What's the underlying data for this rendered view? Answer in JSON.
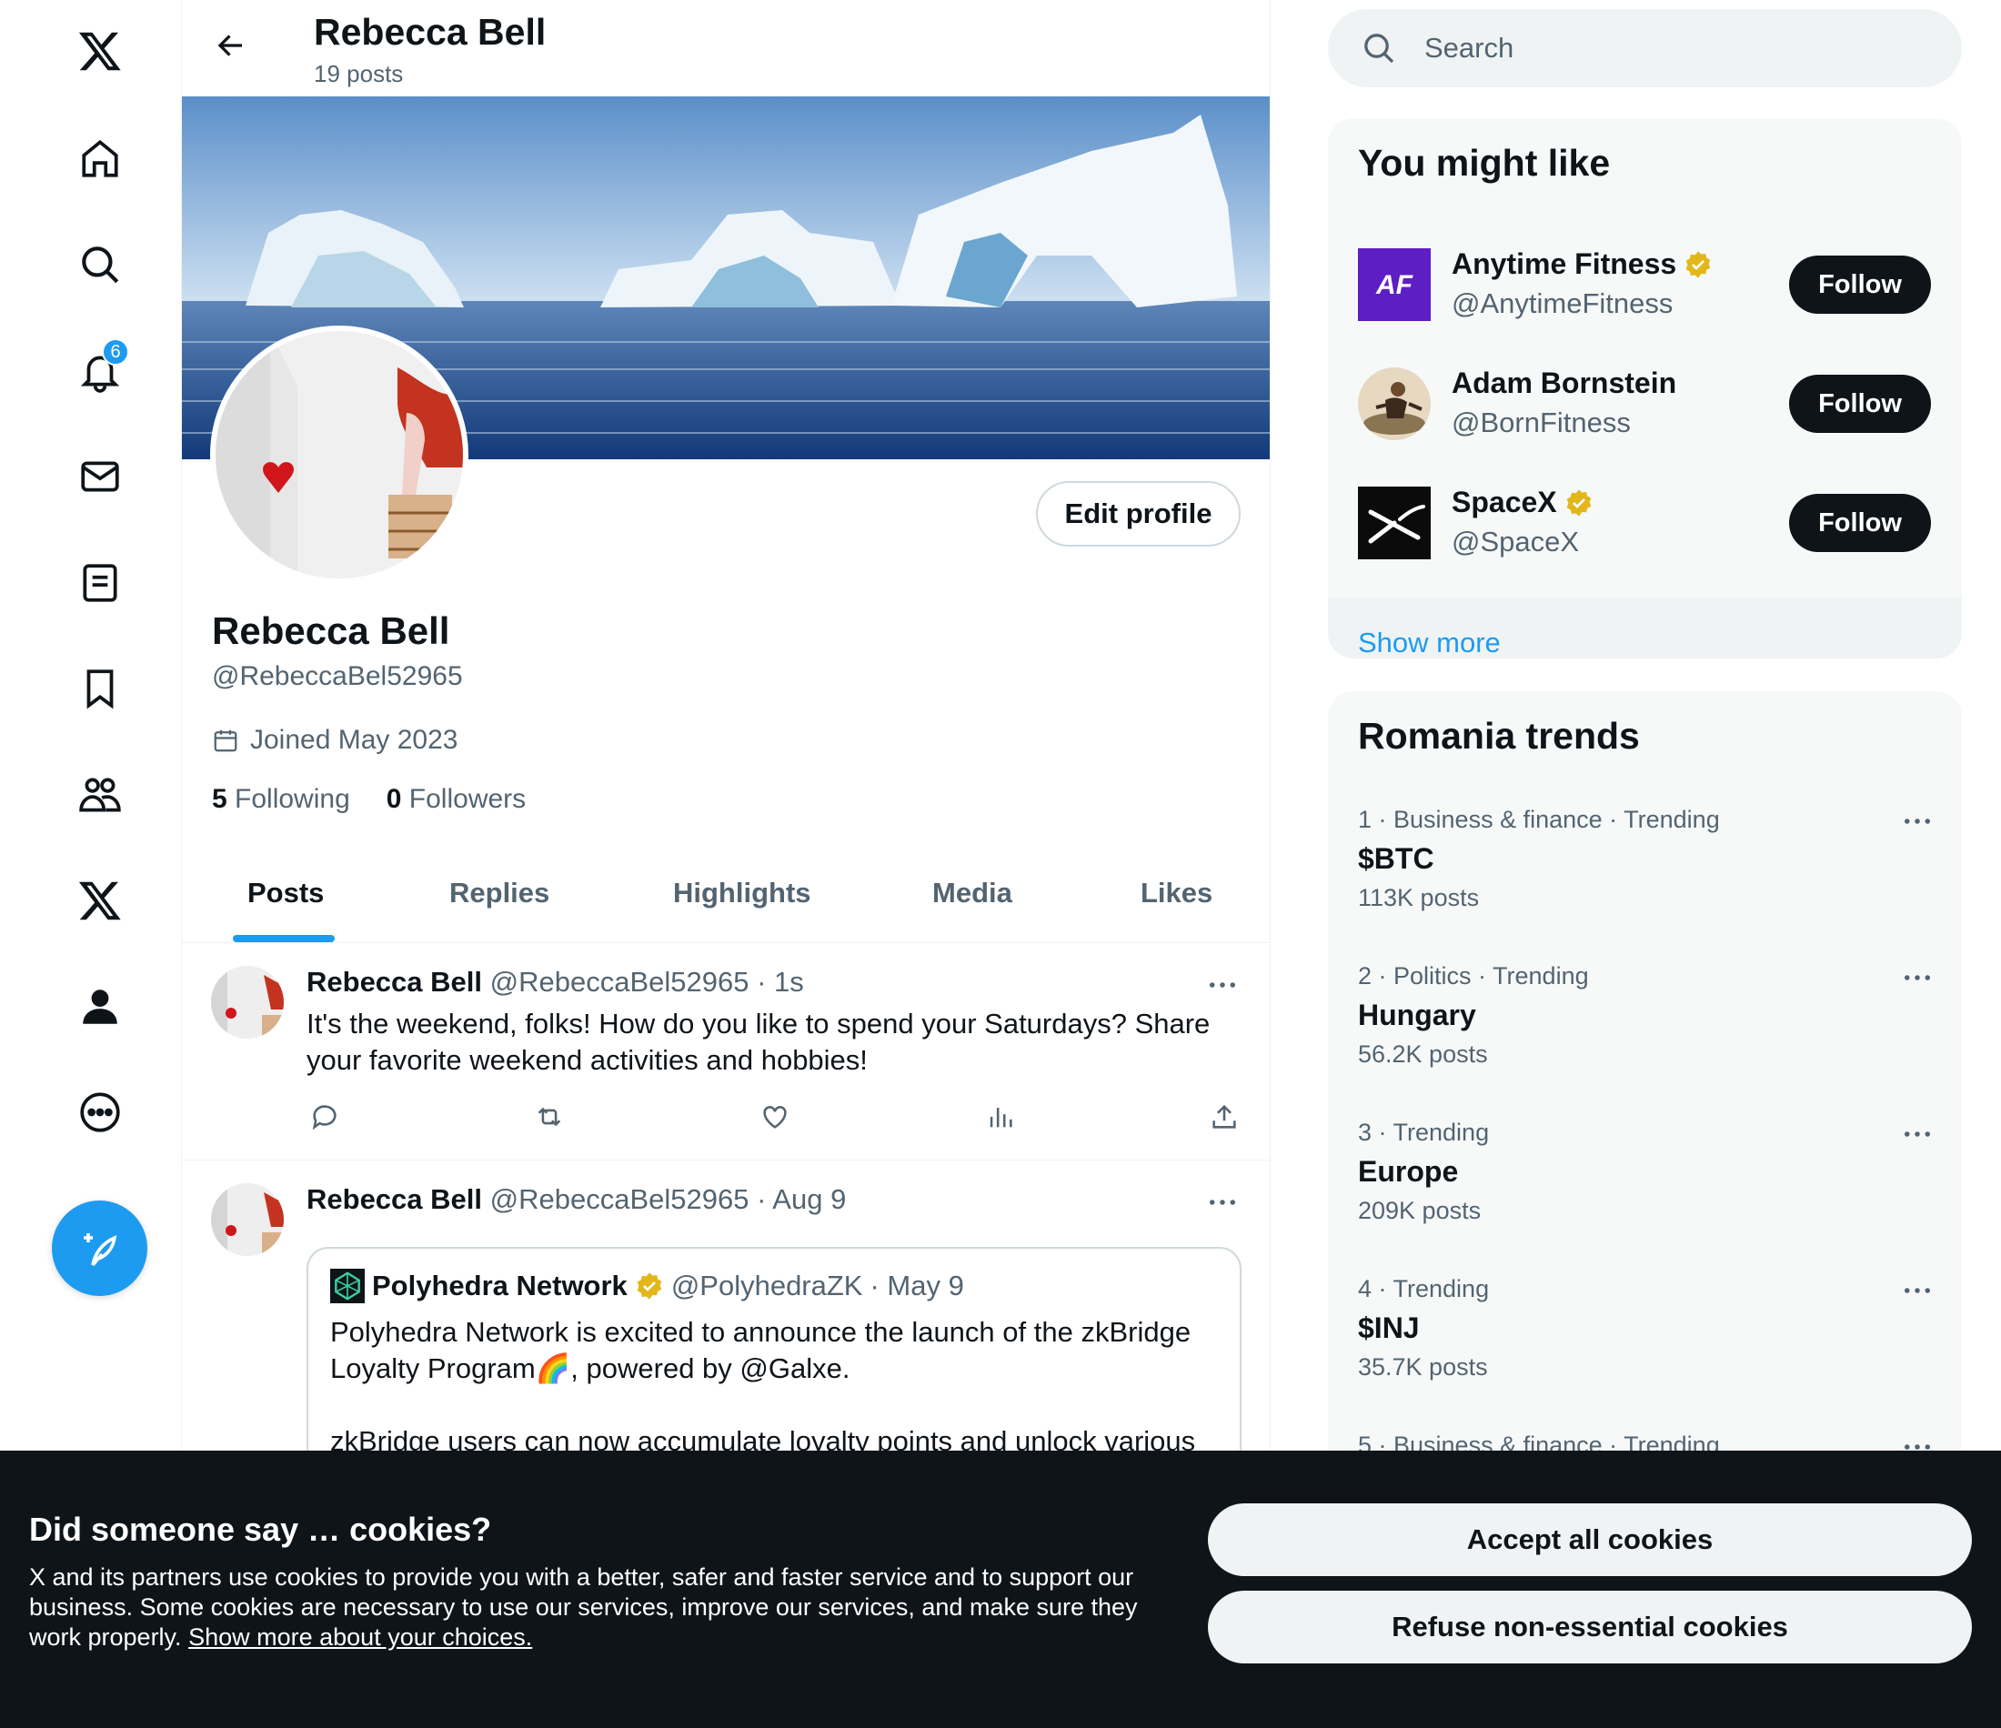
{
  "nav": {
    "items": [
      "x-logo",
      "home",
      "explore",
      "notifications",
      "messages",
      "lists",
      "bookmarks",
      "communities",
      "premium",
      "profile",
      "more"
    ],
    "notification_count": "6"
  },
  "header": {
    "name": "Rebecca Bell",
    "posts_count": "19 posts"
  },
  "profile": {
    "name": "Rebecca Bell",
    "handle": "@RebeccaBel52965",
    "joined": "Joined May 2023",
    "following_count": "5",
    "following_label": "Following",
    "followers_count": "0",
    "followers_label": "Followers",
    "edit_label": "Edit profile"
  },
  "tabs": [
    "Posts",
    "Replies",
    "Highlights",
    "Media",
    "Likes"
  ],
  "active_tab": "Posts",
  "posts": [
    {
      "name": "Rebecca Bell",
      "handle": "@RebeccaBel52965",
      "time": "· 1s",
      "text": "It's the weekend, folks! How do you like to spend your Saturdays? Share your favorite weekend activities and hobbies!"
    },
    {
      "name": "Rebecca Bell",
      "handle": "@RebeccaBel52965",
      "time": "· Aug 9",
      "quote": {
        "name": "Polyhedra Network",
        "handle": "@PolyhedraZK",
        "time": "· May 9",
        "text_line1": "Polyhedra Network is excited to announce the launch of the zkBridge Loyalty Program🌈, powered by @Galxe.",
        "text_line2": "zkBridge users can now accumulate loyalty points and unlock various"
      }
    }
  ],
  "search": {
    "placeholder": "Search"
  },
  "suggestions": {
    "title": "You might like",
    "items": [
      {
        "name": "Anytime Fitness",
        "handle": "@AnytimeFitness",
        "verified": true,
        "button": "Follow"
      },
      {
        "name": "Adam Bornstein",
        "handle": "@BornFitness",
        "verified": false,
        "button": "Follow"
      },
      {
        "name": "SpaceX",
        "handle": "@SpaceX",
        "verified": true,
        "button": "Follow"
      }
    ],
    "show_more": "Show more"
  },
  "trends": {
    "title": "Romania trends",
    "items": [
      {
        "meta": "1 · Business & finance · Trending",
        "name": "$BTC",
        "count": "113K posts"
      },
      {
        "meta": "2 · Politics · Trending",
        "name": "Hungary",
        "count": "56.2K posts"
      },
      {
        "meta": "3 · Trending",
        "name": "Europe",
        "count": "209K posts"
      },
      {
        "meta": "4 · Trending",
        "name": "$INJ",
        "count": "35.7K posts"
      },
      {
        "meta": "5 · Business & finance · Trending",
        "name": "",
        "count": ""
      }
    ]
  },
  "cookie": {
    "title": "Did someone say … cookies?",
    "body": "X and its partners use cookies to provide you with a better, safer and faster service and to support our business. Some cookies are necessary to use our services, improve our services, and make sure they work properly.",
    "link": "Show more about your choices.",
    "accept": "Accept all cookies",
    "refuse": "Refuse non-essential cookies"
  },
  "colors": {
    "accent": "#1d9bf0",
    "text": "#0f1419",
    "muted": "#536471",
    "verified": "#e2b719"
  }
}
